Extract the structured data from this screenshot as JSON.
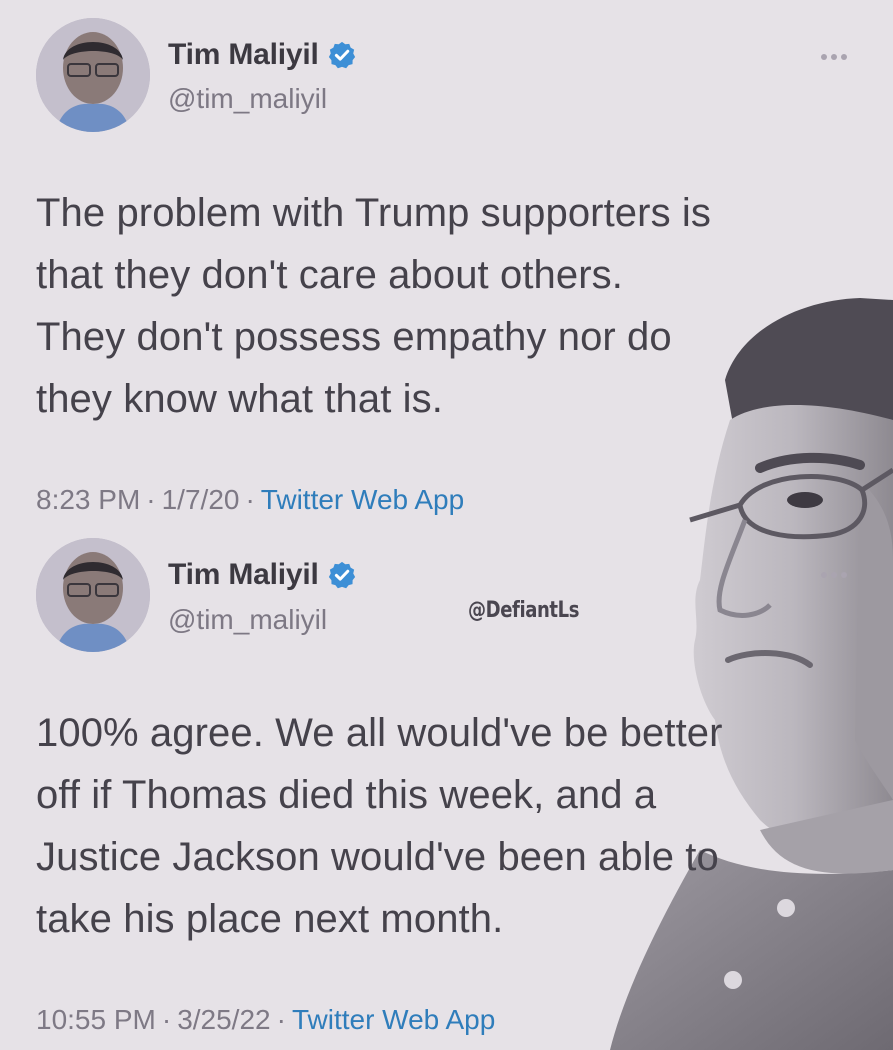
{
  "tweets": [
    {
      "display_name": "Tim Maliyil",
      "handle": "@tim_maliyil",
      "text": "The problem with Trump supporters is\nthat they don't care about others.\nThey don't possess empathy nor do\nthey know what that is.",
      "time": "8:23 PM",
      "date": "1/7/20",
      "source": "Twitter Web App"
    },
    {
      "display_name": "Tim Maliyil",
      "handle": "@tim_maliyil",
      "text": "100% agree. We all would've be better\noff if Thomas died this week, and a\nJustice Jackson would've been able to\ntake his place next month.",
      "time": "10:55 PM",
      "date": "3/25/22",
      "source": "Twitter Web App"
    }
  ],
  "separator": "·",
  "watermark": "@DefiantLs",
  "icons": {
    "verified": "verified-badge-icon",
    "more": "more-options-icon"
  },
  "colors": {
    "background": "#e6e2e7",
    "text": "#45424b",
    "muted": "#7e7985",
    "link": "#2f7dbb",
    "verified": "#3d8fd6"
  }
}
